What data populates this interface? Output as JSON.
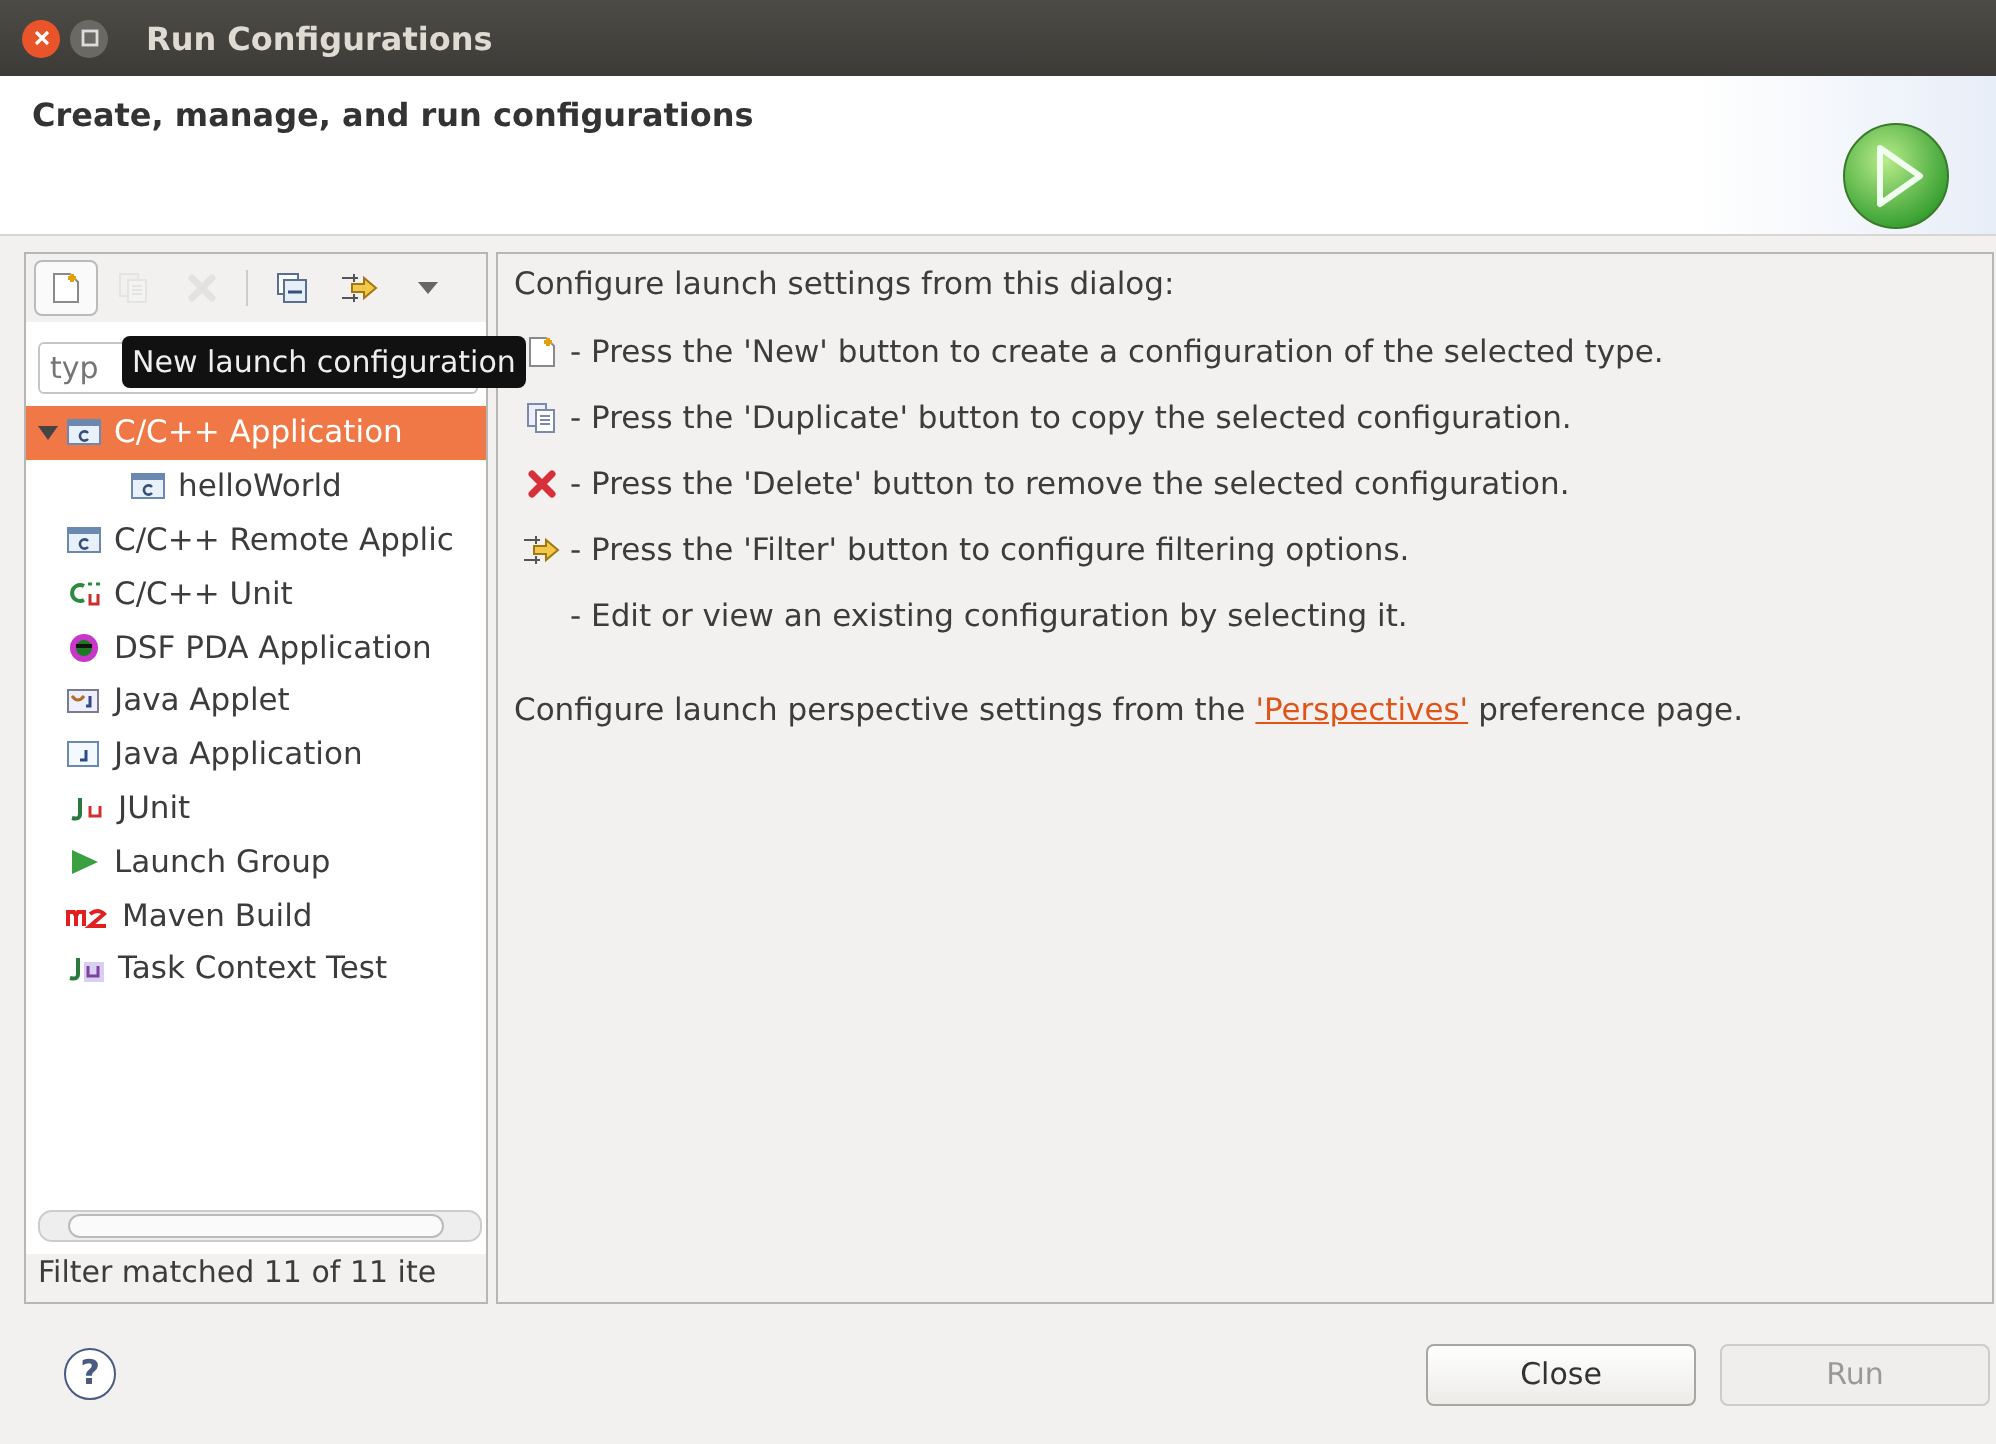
{
  "window": {
    "title": "Run Configurations"
  },
  "header": {
    "title": "Create, manage, and run configurations"
  },
  "toolbar": [
    {
      "kind": "new",
      "disabled": false,
      "hovered": true
    },
    {
      "kind": "duplicate",
      "disabled": true,
      "hovered": false
    },
    {
      "kind": "delete",
      "disabled": true,
      "hovered": false
    },
    {
      "kind": "collapse",
      "disabled": false,
      "hovered": false
    },
    {
      "kind": "filter",
      "disabled": false,
      "hovered": false
    },
    {
      "kind": "menu",
      "disabled": false,
      "hovered": false
    }
  ],
  "tooltip": "New launch configuration",
  "filter_field": {
    "placeholder": "typ"
  },
  "tree": [
    {
      "label": "C/C++ Application",
      "selected": true,
      "expanded": true,
      "children": [
        {
          "label": "helloWorld",
          "selected": false
        }
      ]
    },
    {
      "label": "C/C++ Remote Applic",
      "selected": false
    },
    {
      "label": "C/C++ Unit",
      "selected": false
    },
    {
      "label": "DSF PDA Application",
      "selected": false
    },
    {
      "label": "Java Applet",
      "selected": false
    },
    {
      "label": "Java Application",
      "selected": false
    },
    {
      "label": "JUnit",
      "selected": false
    },
    {
      "label": "Launch Group",
      "selected": false
    },
    {
      "label": "Maven Build",
      "selected": false
    },
    {
      "label": "Task Context Test",
      "selected": false
    }
  ],
  "filter_status": "Filter matched 11 of 11 ite",
  "intro": "Configure launch settings from this dialog:",
  "instructions": [
    {
      "kind": "new",
      "text": "- Press the 'New' button to create a configuration of the selected type."
    },
    {
      "kind": "duplicate",
      "text": "- Press the 'Duplicate' button to copy the selected configuration."
    },
    {
      "kind": "delete",
      "text": "- Press the 'Delete' button to remove the selected configuration."
    },
    {
      "kind": "filter",
      "text": "- Press the 'Filter' button to configure filtering options."
    },
    {
      "kind": "none",
      "text": "- Edit or view an existing configuration by selecting it."
    }
  ],
  "perspective_note": {
    "before": "Configure launch perspective settings from the",
    "link": "'Perspectives'",
    "after": "preference page."
  },
  "help": "?",
  "buttons": [
    {
      "label": "Close",
      "disabled": false
    },
    {
      "label": "Run",
      "disabled": true
    }
  ]
}
